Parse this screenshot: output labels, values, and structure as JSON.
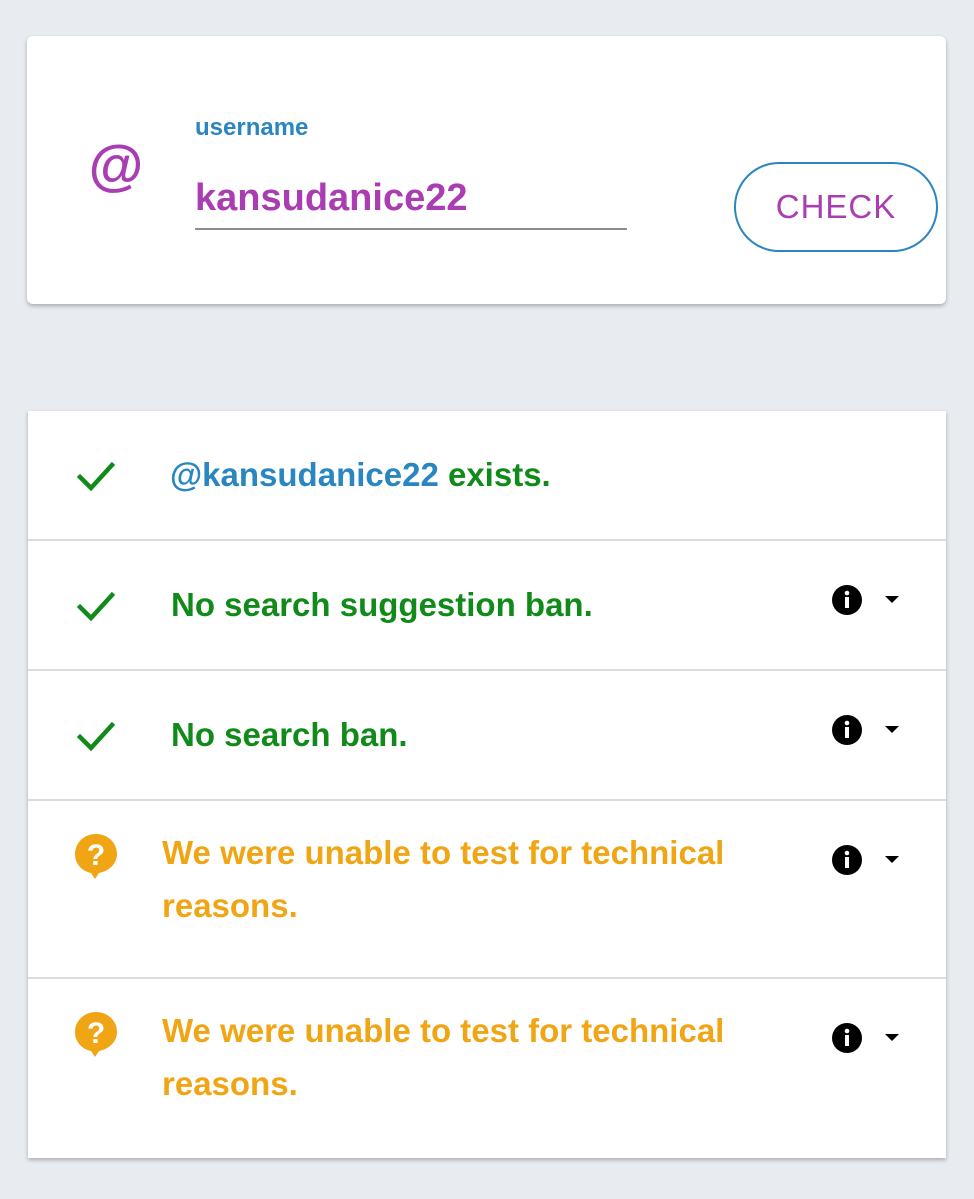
{
  "search": {
    "label": "username",
    "value": "kansudanice22",
    "at_symbol": "@",
    "button_label": "CHECK"
  },
  "results": [
    {
      "status": "ok",
      "icon": "check-icon",
      "handle": "@kansudanice22",
      "text": " exists."
    },
    {
      "status": "ok",
      "icon": "check-icon",
      "text": "No search suggestion ban."
    },
    {
      "status": "ok",
      "icon": "check-icon",
      "text": "No search ban."
    },
    {
      "status": "unknown",
      "icon": "question-bubble-icon",
      "text_line1": "We were unable to test for technical",
      "text_line2": "reasons."
    },
    {
      "status": "unknown",
      "icon": "question-bubble-icon",
      "text_line1": "We were unable to test for technical",
      "text_line2": "reasons."
    }
  ],
  "colors": {
    "accent_purple": "#a93db1",
    "accent_blue": "#2a86c0",
    "ok_green": "#108a19",
    "warn_orange": "#f0a514",
    "background": "#e8ecf0"
  }
}
